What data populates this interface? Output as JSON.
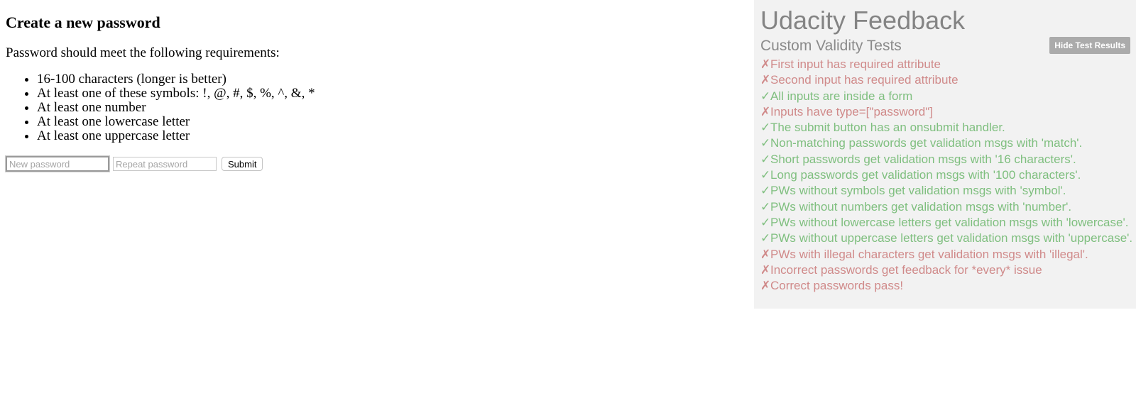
{
  "page": {
    "title": "Create a new password",
    "intro": "Password should meet the following requirements:",
    "requirements": [
      "16-100 characters (longer is better)",
      "At least one of these symbols: !, @, #, $, %, ^, &, *",
      "At least one number",
      "At least one lowercase letter",
      "At least one uppercase letter"
    ],
    "form": {
      "new_password_placeholder": "New password",
      "repeat_password_placeholder": "Repeat password",
      "submit_label": "Submit"
    }
  },
  "feedback": {
    "title": "Udacity Feedback",
    "subtitle": "Custom Validity Tests",
    "hide_button_label": "Hide Test Results",
    "colors": {
      "pass": "#7fbf7f",
      "fail": "#d08a8a",
      "panel_bg": "#f2f2f2"
    },
    "tests": [
      {
        "mark": "✗",
        "status": "fail",
        "text": "First input has required attribute"
      },
      {
        "mark": "✗",
        "status": "fail",
        "text": "Second input has required attribute"
      },
      {
        "mark": "✓",
        "status": "pass",
        "text": "All inputs are inside a form"
      },
      {
        "mark": "✗",
        "status": "fail",
        "text": "Inputs have type=[\"password\"]"
      },
      {
        "mark": "✓",
        "status": "pass",
        "text": "The submit button has an onsubmit handler."
      },
      {
        "mark": "✓",
        "status": "pass",
        "text": "Non-matching passwords get validation msgs with 'match'."
      },
      {
        "mark": "✓",
        "status": "pass",
        "text": "Short passwords get validation msgs with '16 characters'."
      },
      {
        "mark": "✓",
        "status": "pass",
        "text": "Long passwords get validation msgs with '100 characters'."
      },
      {
        "mark": "✓",
        "status": "pass",
        "text": "PWs without symbols get validation msgs with 'symbol'."
      },
      {
        "mark": "✓",
        "status": "pass",
        "text": "PWs without numbers get validation msgs with 'number'."
      },
      {
        "mark": "✓",
        "status": "pass",
        "text": "PWs without lowercase letters get validation msgs with 'lowercase'."
      },
      {
        "mark": "✓",
        "status": "pass",
        "text": "PWs without uppercase letters get validation msgs with 'uppercase'."
      },
      {
        "mark": "✗",
        "status": "fail",
        "text": "PWs with illegal characters get validation msgs with 'illegal'."
      },
      {
        "mark": "✗",
        "status": "fail",
        "text": "Incorrect passwords get feedback for *every* issue"
      },
      {
        "mark": "✗",
        "status": "fail",
        "text": "Correct passwords pass!"
      }
    ]
  }
}
